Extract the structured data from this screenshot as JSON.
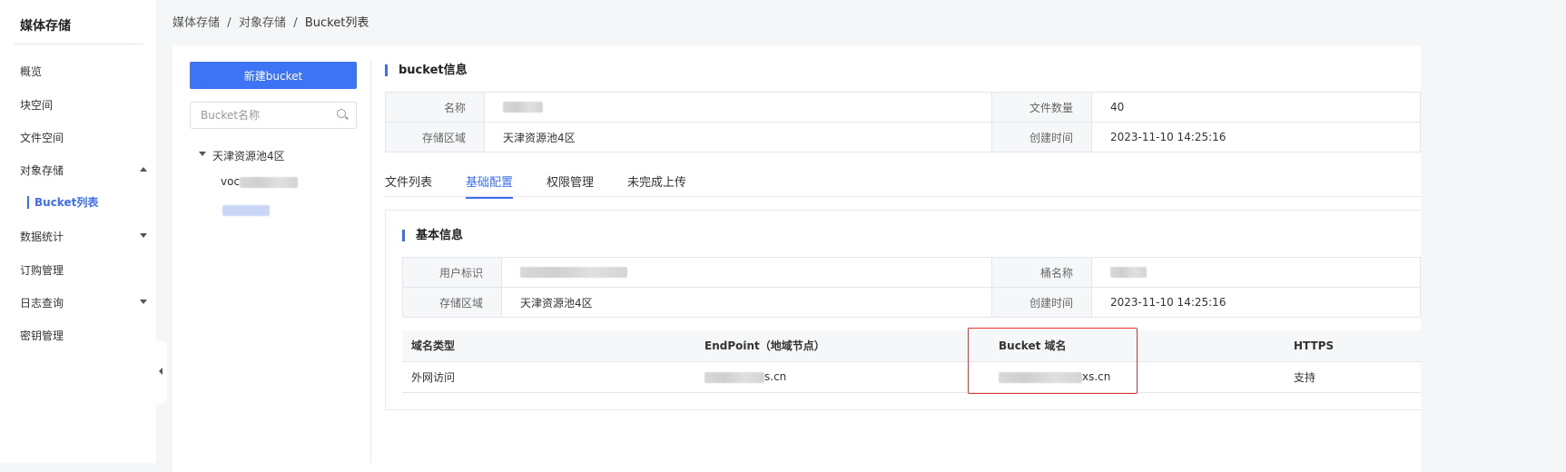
{
  "sidebar": {
    "title": "媒体存储",
    "items": [
      {
        "label": "概览"
      },
      {
        "label": "块空间"
      },
      {
        "label": "文件空间"
      },
      {
        "label": "对象存储"
      },
      {
        "label": "Bucket列表"
      },
      {
        "label": "数据统计"
      },
      {
        "label": "订购管理"
      },
      {
        "label": "日志查询"
      },
      {
        "label": "密钥管理"
      }
    ]
  },
  "breadcrumb": [
    "媒体存储",
    "对象存储",
    "Bucket列表"
  ],
  "left_panel": {
    "new_button": "新建bucket",
    "search_placeholder": "Bucket名称",
    "tree_region": "天津资源池4区",
    "tree_items": [
      "voc"
    ]
  },
  "bucket_info": {
    "title": "bucket信息",
    "rows": [
      {
        "label1": "名称",
        "value1": "",
        "label2": "文件数量",
        "value2": "40"
      },
      {
        "label1": "存储区域",
        "value1": "天津资源池4区",
        "label2": "创建时间",
        "value2": "2023-11-10 14:25:16"
      }
    ]
  },
  "tabs": [
    {
      "label": "文件列表"
    },
    {
      "label": "基础配置",
      "active": true
    },
    {
      "label": "权限管理"
    },
    {
      "label": "未完成上传"
    }
  ],
  "basic_info": {
    "title": "基本信息",
    "rows": [
      {
        "label1": "用户标识",
        "value1": "",
        "label2": "桶名称",
        "value2": ""
      },
      {
        "label1": "存储区域",
        "value1": "天津资源池4区",
        "label2": "创建时间",
        "value2": "2023-11-10 14:25:16"
      }
    ]
  },
  "domain_table": {
    "headers": [
      "域名类型",
      "EndPoint（地域节点）",
      "Bucket 域名",
      "HTTPS"
    ],
    "rows": [
      {
        "type": "外网访问",
        "endpoint_suffix": "s.cn",
        "domain_suffix": "xs.cn",
        "https": "支持"
      }
    ]
  },
  "colors": {
    "accent": "#3d6ef5",
    "highlight_box": "#e5322d"
  }
}
